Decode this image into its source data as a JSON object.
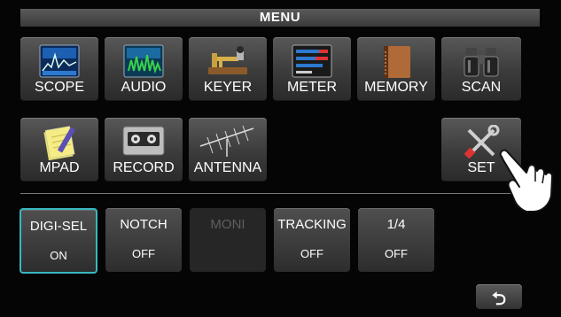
{
  "menu": {
    "title": "MENU"
  },
  "tiles": [
    {
      "label": "SCOPE",
      "icon": "scope-icon"
    },
    {
      "label": "AUDIO",
      "icon": "audio-icon"
    },
    {
      "label": "KEYER",
      "icon": "keyer-icon"
    },
    {
      "label": "METER",
      "icon": "meter-icon"
    },
    {
      "label": "MEMORY",
      "icon": "memory-icon"
    },
    {
      "label": "SCAN",
      "icon": "binoculars-icon"
    },
    {
      "label": "MPAD",
      "icon": "notepad-icon"
    },
    {
      "label": "RECORD",
      "icon": "cassette-icon"
    },
    {
      "label": "ANTENNA",
      "icon": "antenna-icon"
    },
    {
      "label": "SET",
      "icon": "tools-icon"
    }
  ],
  "functions": [
    {
      "label": "DIGI-SEL",
      "value": "ON"
    },
    {
      "label": "NOTCH",
      "value": "OFF"
    },
    {
      "label": "MONI",
      "value": ""
    },
    {
      "label": "TRACKING",
      "value": "OFF"
    },
    {
      "label": "1/4",
      "value": "OFF"
    }
  ],
  "back": {
    "icon": "return-arrow-icon",
    "glyph": "⮌"
  },
  "colors": {
    "selected_border": "#38b7c0",
    "background": "#050505"
  }
}
